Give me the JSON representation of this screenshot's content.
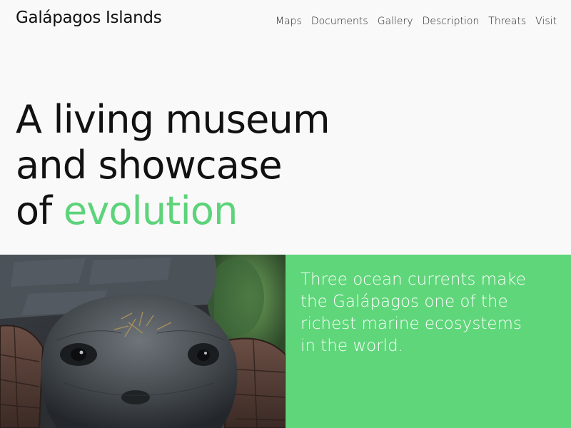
{
  "header": {
    "site_title": "Galápagos Islands",
    "nav": [
      "Maps",
      "Documents",
      "Gallery",
      "Description",
      "Threats",
      "Visit"
    ]
  },
  "hero": {
    "line1": "A living museum",
    "line2": "and showcase",
    "line3_prefix": "of ",
    "line3_accent": "evolution"
  },
  "info": {
    "text": "Three ocean currents make the Galápagos one of the richest marine ecosystems in the world."
  },
  "photo": {
    "subject": "giant tortoise"
  },
  "colors": {
    "accent": "#5dd37a",
    "panel": "#5fd67a",
    "background": "#f9f9f9",
    "text": "#111111"
  }
}
